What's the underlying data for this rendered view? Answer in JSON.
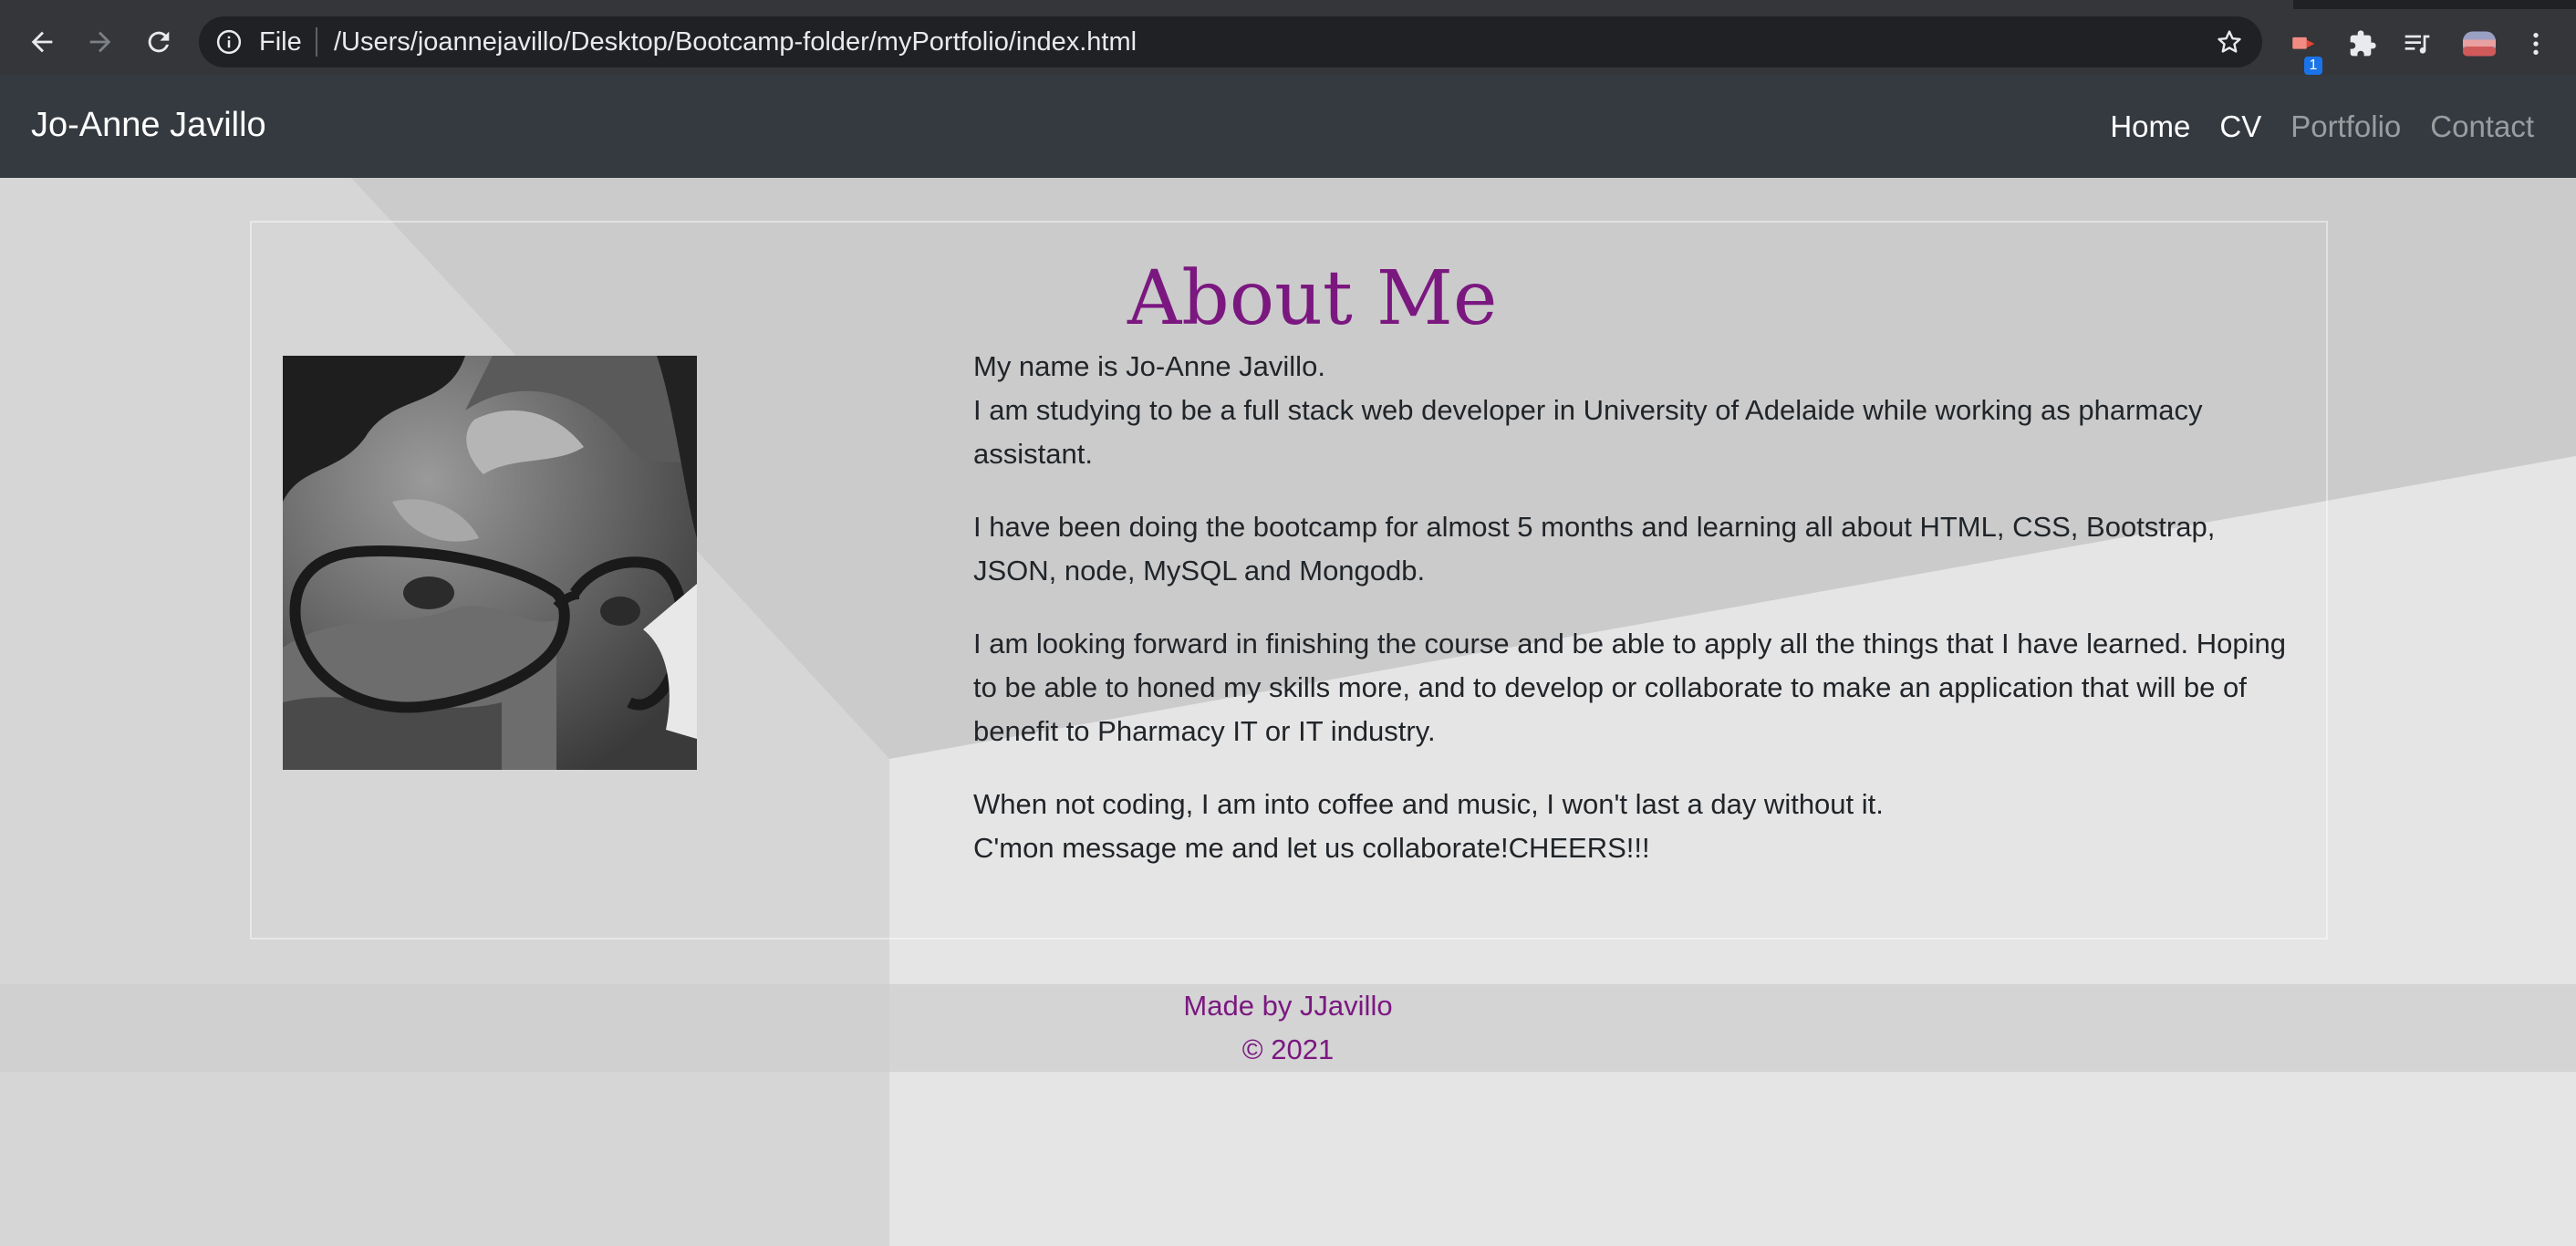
{
  "browser": {
    "file_label": "File",
    "url": "/Users/joannejavillo/Desktop/Bootcamp-folder/myPortfolio/index.html",
    "extension_badge": "1"
  },
  "navbar": {
    "brand": "Jo-Anne Javillo",
    "links": [
      {
        "label": "Home",
        "active": true
      },
      {
        "label": "CV",
        "active": true
      },
      {
        "label": "Portfolio",
        "active": false
      },
      {
        "label": "Contact",
        "active": false
      }
    ]
  },
  "about": {
    "title": "About Me",
    "paragraphs": [
      {
        "line1": "My name is Jo-Anne Javillo.",
        "line2": "I am studying to be a full stack web developer in University of Adelaide while working as pharmacy assistant."
      },
      {
        "line1": "I have been doing the bootcamp for almost 5 months and learning all about HTML, CSS, Bootstrap, JSON, node, MySQL and Mongodb."
      },
      {
        "line1": "I am looking forward in finishing the course and be able to apply all the things that I have learned. Hoping to be able to honed my skills more, and to develop or collaborate to make an application that will be of benefit to Pharmacy IT or IT industry."
      },
      {
        "line1": "When not coding, I am into coffee and music, I won't last a day without it.",
        "line2": "C'mon message me and let us collaborate!CHEERS!!!"
      }
    ]
  },
  "footer": {
    "made_by": "Made by JJavillo",
    "copyright": "© 2021"
  },
  "colors": {
    "navbar_bg": "#343a40",
    "accent_purple": "#7b1880",
    "chrome_bg": "#35363a"
  }
}
